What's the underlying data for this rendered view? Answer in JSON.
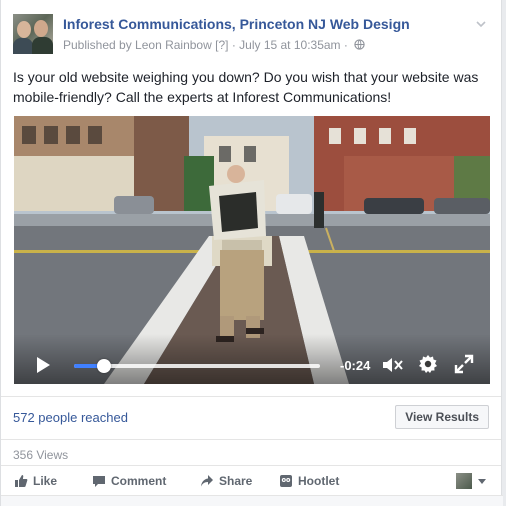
{
  "post": {
    "page_name": "Inforest Communications, Princeton NJ Web Design",
    "published_by": "Published by Leon Rainbow",
    "help_mark": "[?]",
    "separator": "·",
    "timestamp": "July 15 at 10:35am",
    "audience_icon": "globe-icon",
    "text": "Is your old website weighing you down? Do you wish that your website was mobile-friendly? Call the experts at Inforest Communications!"
  },
  "video": {
    "play_icon": "play-icon",
    "progress_fraction": 0.12,
    "time_remaining": "-0:24",
    "mute_icon": "mute-icon",
    "settings_icon": "gear-icon",
    "fullscreen_icon": "fullscreen-icon",
    "accent_color": "#4080ff"
  },
  "insights": {
    "reach": "572 people reached",
    "view_results": "View Results",
    "views": "356 Views"
  },
  "actions": {
    "like": "Like",
    "comment": "Comment",
    "share": "Share",
    "hootlet": "Hootlet"
  },
  "colors": {
    "link": "#365899",
    "meta": "#90949c",
    "action": "#606770"
  }
}
